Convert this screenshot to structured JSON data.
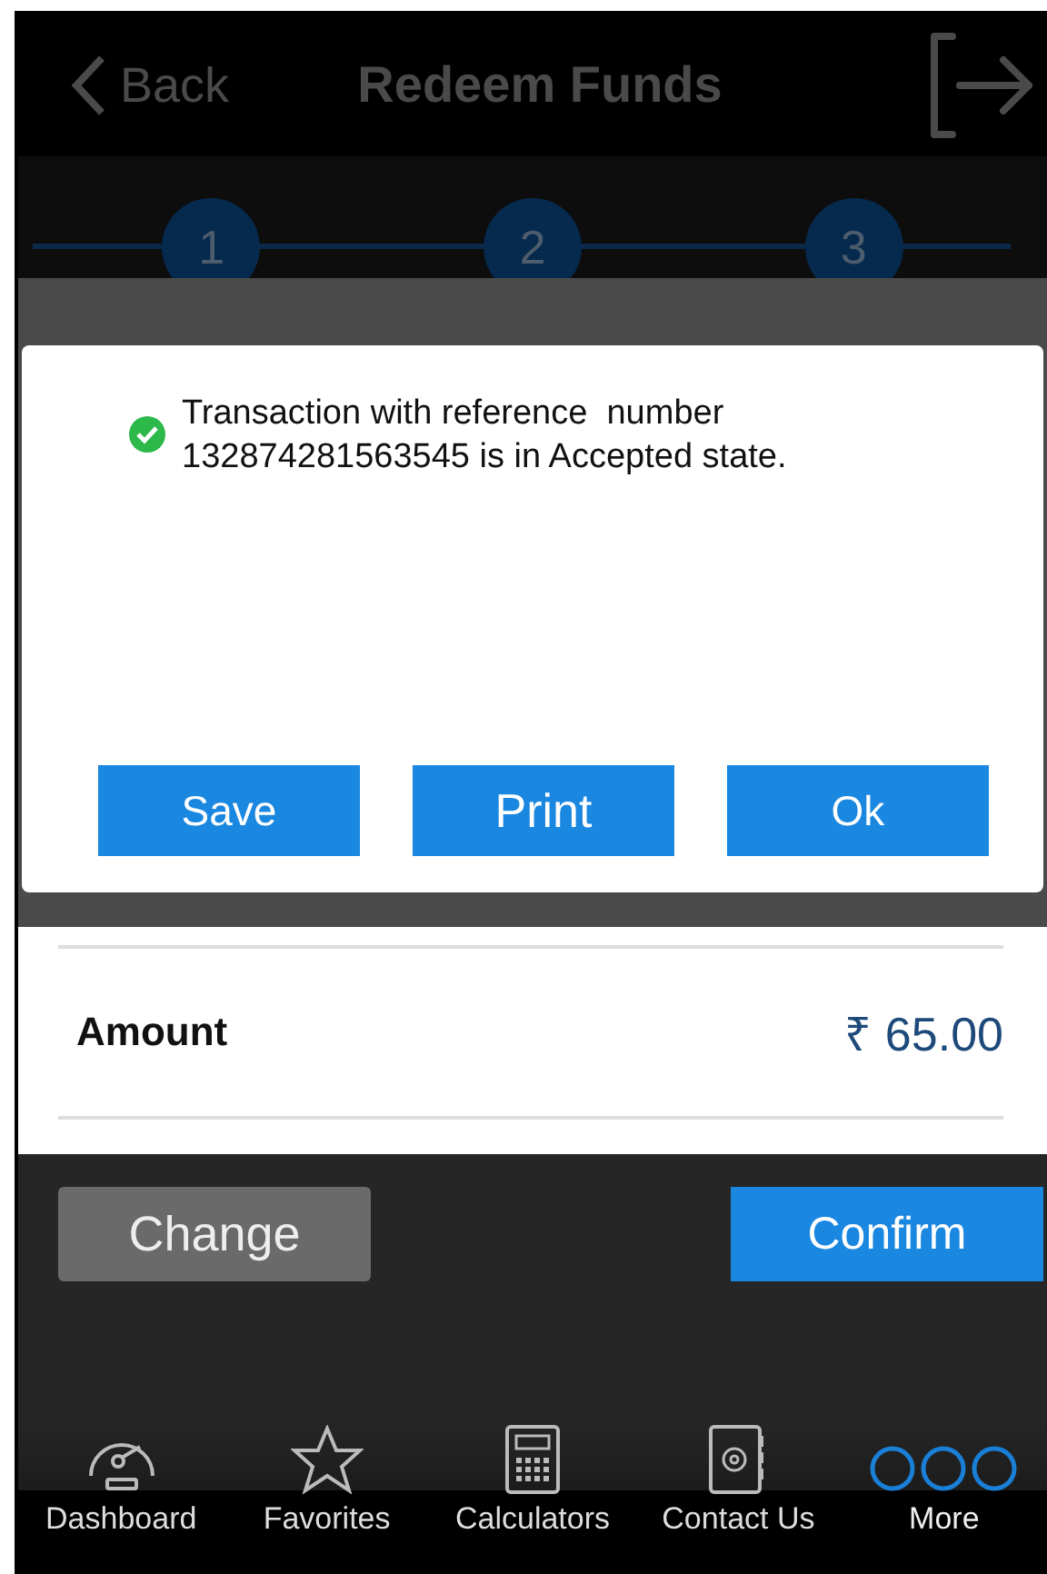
{
  "header": {
    "back": "Back",
    "title": "Redeem Funds"
  },
  "steps": [
    "1",
    "2",
    "3"
  ],
  "dialog": {
    "message": "Transaction with reference  number 132874281563545 is in Accepted state.",
    "buttons": [
      "Save",
      "Print",
      "Ok"
    ]
  },
  "summary": {
    "label": "Amount",
    "value": "₹ 65.00"
  },
  "actions": [
    {
      "label": "Change",
      "kind": "secondary"
    },
    {
      "label": "Confirm",
      "kind": "primary"
    }
  ],
  "tabs": [
    {
      "label": "Dashboard",
      "selected": false
    },
    {
      "label": "Favorites",
      "selected": false
    },
    {
      "label": "Calculators",
      "selected": false
    },
    {
      "label": "Contact Us",
      "selected": false
    },
    {
      "label": "More",
      "selected": true
    }
  ]
}
